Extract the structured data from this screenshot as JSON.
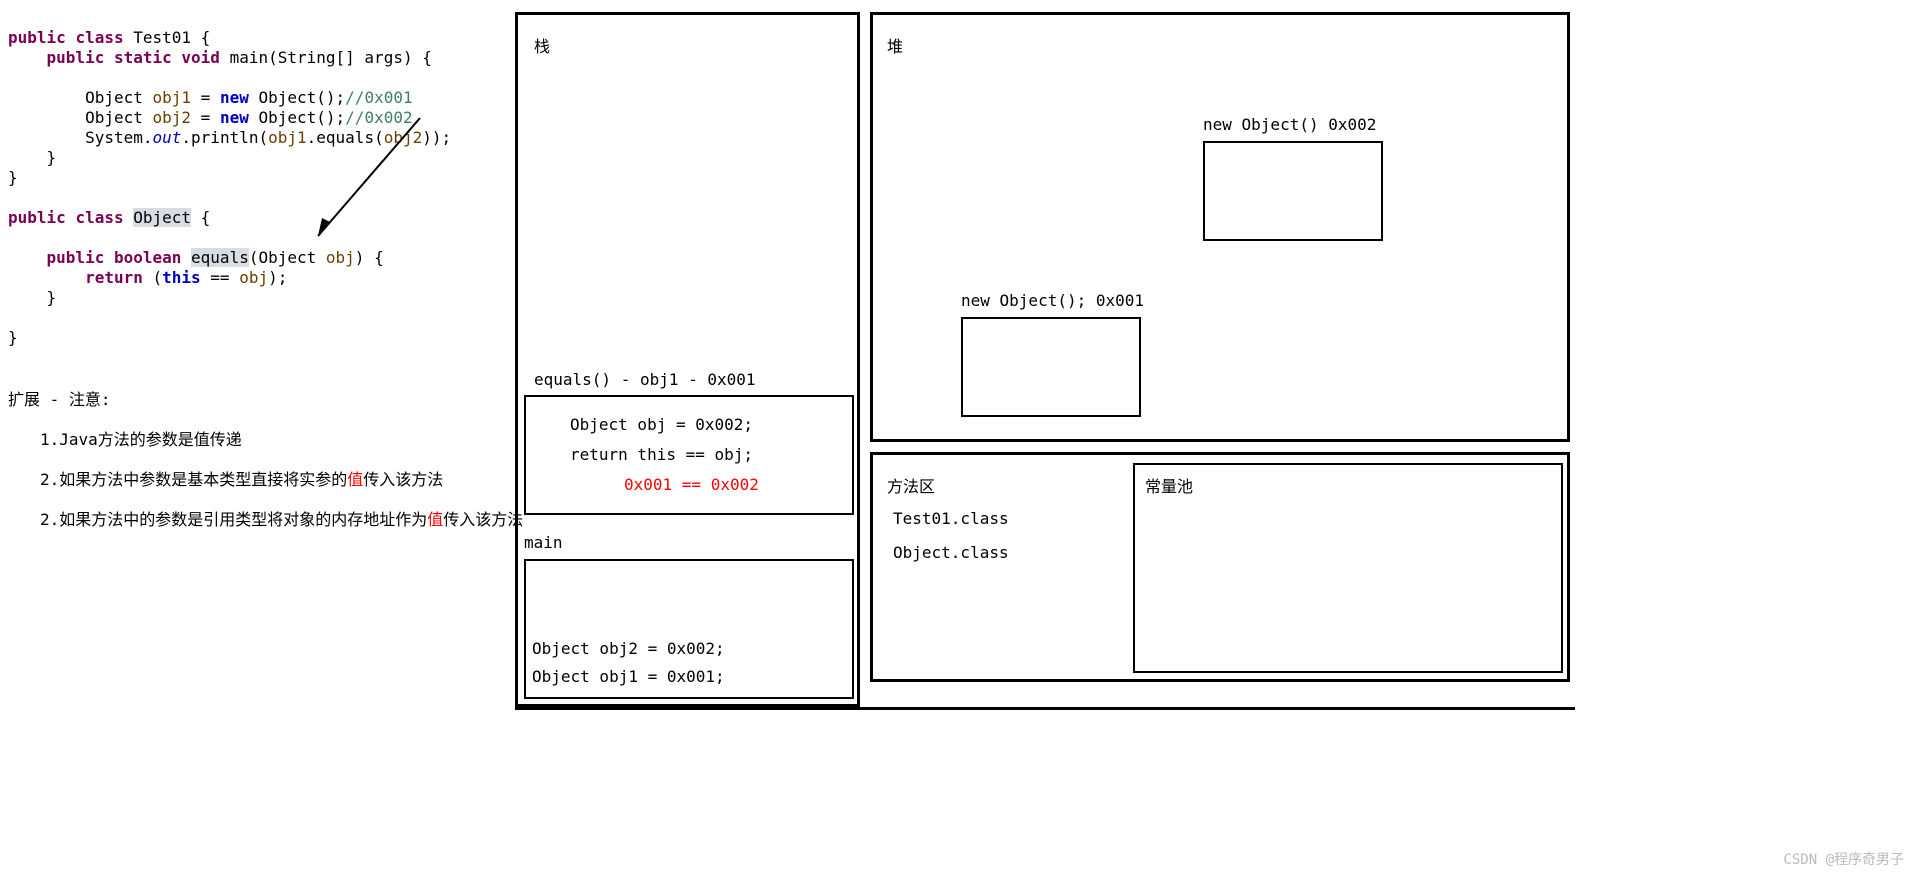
{
  "code": {
    "l1": {
      "kw_public": "public",
      "kw_class": "class",
      "name": "Test01",
      "brace": " {"
    },
    "l2": {
      "indent": "    ",
      "kw_public": "public",
      "kw_static": "static",
      "kw_void": " void ",
      "fn": "main",
      "params": "(String[] args) {"
    },
    "l3": "",
    "l4": {
      "indent": "        ",
      "t": "Object ",
      "v": "obj1",
      " eq": " = ",
      "kw_new": "new ",
      "call": "Object();",
      "cmt": "//0x001"
    },
    "l5": {
      "indent": "        ",
      "t": "Object ",
      "v": "obj2",
      " eq": " = ",
      "kw_new": "new ",
      "call": "Object();",
      "cmt": "//0x002"
    },
    "l6": {
      "indent": "        ",
      "sys": "System.",
      "out": "out",
      "p": ".println(",
      "v1": "obj1",
      "eq": ".equals(",
      "v2": "obj2",
      "end": "));"
    },
    "l7": "    }",
    "l8": "}",
    "l9": "",
    "l10": {
      "kw_public": "public",
      "kw_class": "class",
      "name": "Object",
      "brace": " {"
    },
    "l11": "",
    "l12": {
      "indent": "    ",
      "kw_public": "public",
      "kw_boolean": " boolean ",
      "fn": "equals",
      "paren": "(Object ",
      "param": "obj",
      "end": ") {"
    },
    "l13": {
      "indent": "        ",
      "kw_return": "return",
      "open": " (",
      "this": "this",
      "eq": " == ",
      "var": "obj",
      "end": ");"
    },
    "l14": "    }",
    "l15": "",
    "l16": "}"
  },
  "notes": {
    "title": "扩展 - 注意:",
    "n1": "1.Java方法的参数是值传递",
    "n2a": "2.如果方法中参数是基本类型直接将实参的",
    "n2b": "值",
    "n2c": "传入该方法",
    "n3a": "2.如果方法中的参数是引用类型将对象的内存地址作为",
    "n3b": "值",
    "n3c": "传入该方法"
  },
  "stack": {
    "title": "栈",
    "equals_label": "equals() - obj1 - 0x001",
    "eq_l1": "Object obj = 0x002;",
    "eq_l2": "return this == obj;",
    "eq_l3": "0x001 == 0x002",
    "main_label": "main",
    "m1": "Object obj2 = 0x002;",
    "m2": "Object obj1 = 0x001;"
  },
  "heap": {
    "title": "堆",
    "o1_label": "new Object();  0x001",
    "o2_label": "new Object()   0x002"
  },
  "method_area": {
    "title": "方法区",
    "c1": "Test01.class",
    "c2": "Object.class"
  },
  "const_pool": {
    "title": "常量池"
  },
  "watermark": "CSDN @程序奇男子"
}
